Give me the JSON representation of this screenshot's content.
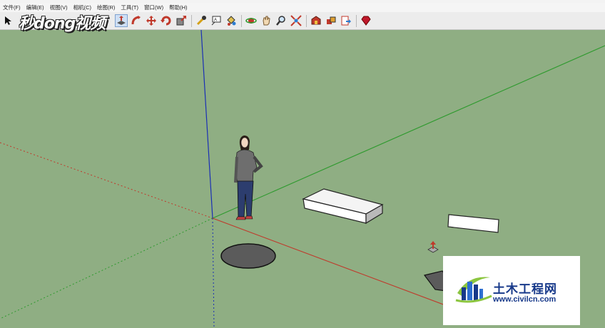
{
  "menubar": {
    "items": [
      {
        "label": "文件(F)"
      },
      {
        "label": "编辑(E)"
      },
      {
        "label": "视图(V)"
      },
      {
        "label": "相机(C)"
      },
      {
        "label": "绘图(R)"
      },
      {
        "label": "工具(T)"
      },
      {
        "label": "窗口(W)"
      },
      {
        "label": "帮助(H)"
      }
    ]
  },
  "toolbar": {
    "icons": [
      "select-arrow-icon",
      "pushpull-icon",
      "followme-icon",
      "move-icon",
      "rotate-icon",
      "scale-icon",
      "tape-measure-icon",
      "text-icon",
      "paint-bucket-icon",
      "orbit-icon",
      "pan-icon",
      "zoom-icon",
      "zoom-extents-icon",
      "warehouse-icon",
      "components-icon",
      "export-icon",
      "ruby-icon"
    ],
    "active": "pushpull-icon"
  },
  "watermark_left": {
    "text": "秒dong视频"
  },
  "watermark_right": {
    "title": "土木工程网",
    "url": "www.civilcn.com"
  },
  "colors": {
    "background": "#8fae83",
    "axis_red": "#c0392b",
    "axis_green": "#2e9a2e",
    "axis_blue": "#1a2fb5",
    "watermark_blue": "#17398a",
    "watermark_green": "#8cc63f"
  }
}
